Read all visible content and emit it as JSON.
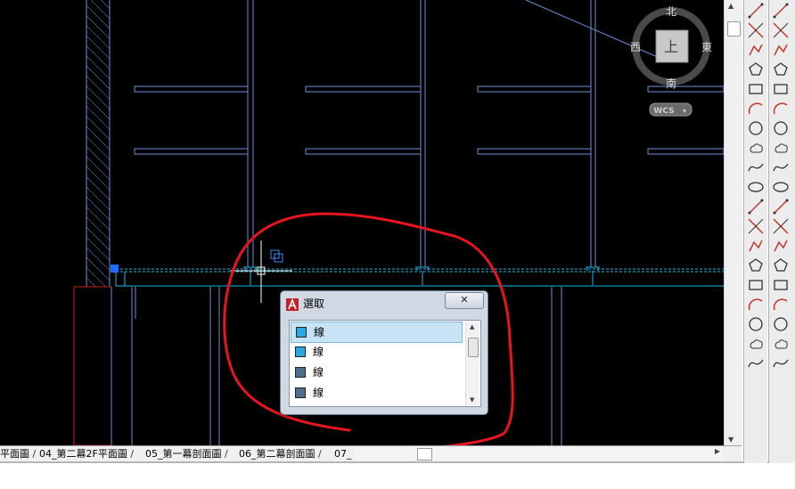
{
  "viewcube": {
    "north": "北",
    "south": "南",
    "east": "東",
    "west": "西",
    "face": "上",
    "wcs_label": "WCS"
  },
  "dialog": {
    "title": "選取",
    "close_label": "✕",
    "items": [
      {
        "label": "線",
        "color": "#29a9e0",
        "selected": true
      },
      {
        "label": "線",
        "color": "#29a9e0",
        "selected": false
      },
      {
        "label": "線",
        "color": "#4f6d8f",
        "selected": false
      },
      {
        "label": "線",
        "color": "#4f6d8f",
        "selected": false
      }
    ]
  },
  "layout_tabs": [
    "平面圖",
    "04_第二幕2F平面圖",
    "05_第一幕剖面圖",
    "06_第二幕剖面圖",
    "07_"
  ],
  "colors": {
    "canvas": "#000000",
    "cad_line": "#6f8fd6",
    "cad_cyan": "#19b8e8",
    "cad_red": "#c81e1e",
    "annotation_red": "#e8141e"
  },
  "toolbar_icons": [
    "line-icon",
    "construction-line-icon",
    "polyline-icon",
    "polygon-icon",
    "rectangle-icon",
    "arc-icon",
    "circle-icon",
    "revision-cloud-icon",
    "spline-icon",
    "ellipse-icon",
    "insert-block-icon",
    "make-block-icon",
    "point-icon",
    "hatch-icon",
    "gradient-icon",
    "region-icon",
    "table-icon",
    "multiline-text-icon",
    "add-selected-icon"
  ],
  "modify_icons": [
    "erase-icon",
    "copy-icon",
    "mirror-icon",
    "offset-icon",
    "array-icon",
    "move-icon",
    "rotate-icon",
    "scale-icon",
    "stretch-icon",
    "trim-icon",
    "extend-icon",
    "break-icon",
    "join-icon",
    "chamfer-icon",
    "fillet-icon",
    "explode-icon",
    "dim-linear-icon",
    "dim-aligned-icon",
    "dim-angular-icon"
  ]
}
